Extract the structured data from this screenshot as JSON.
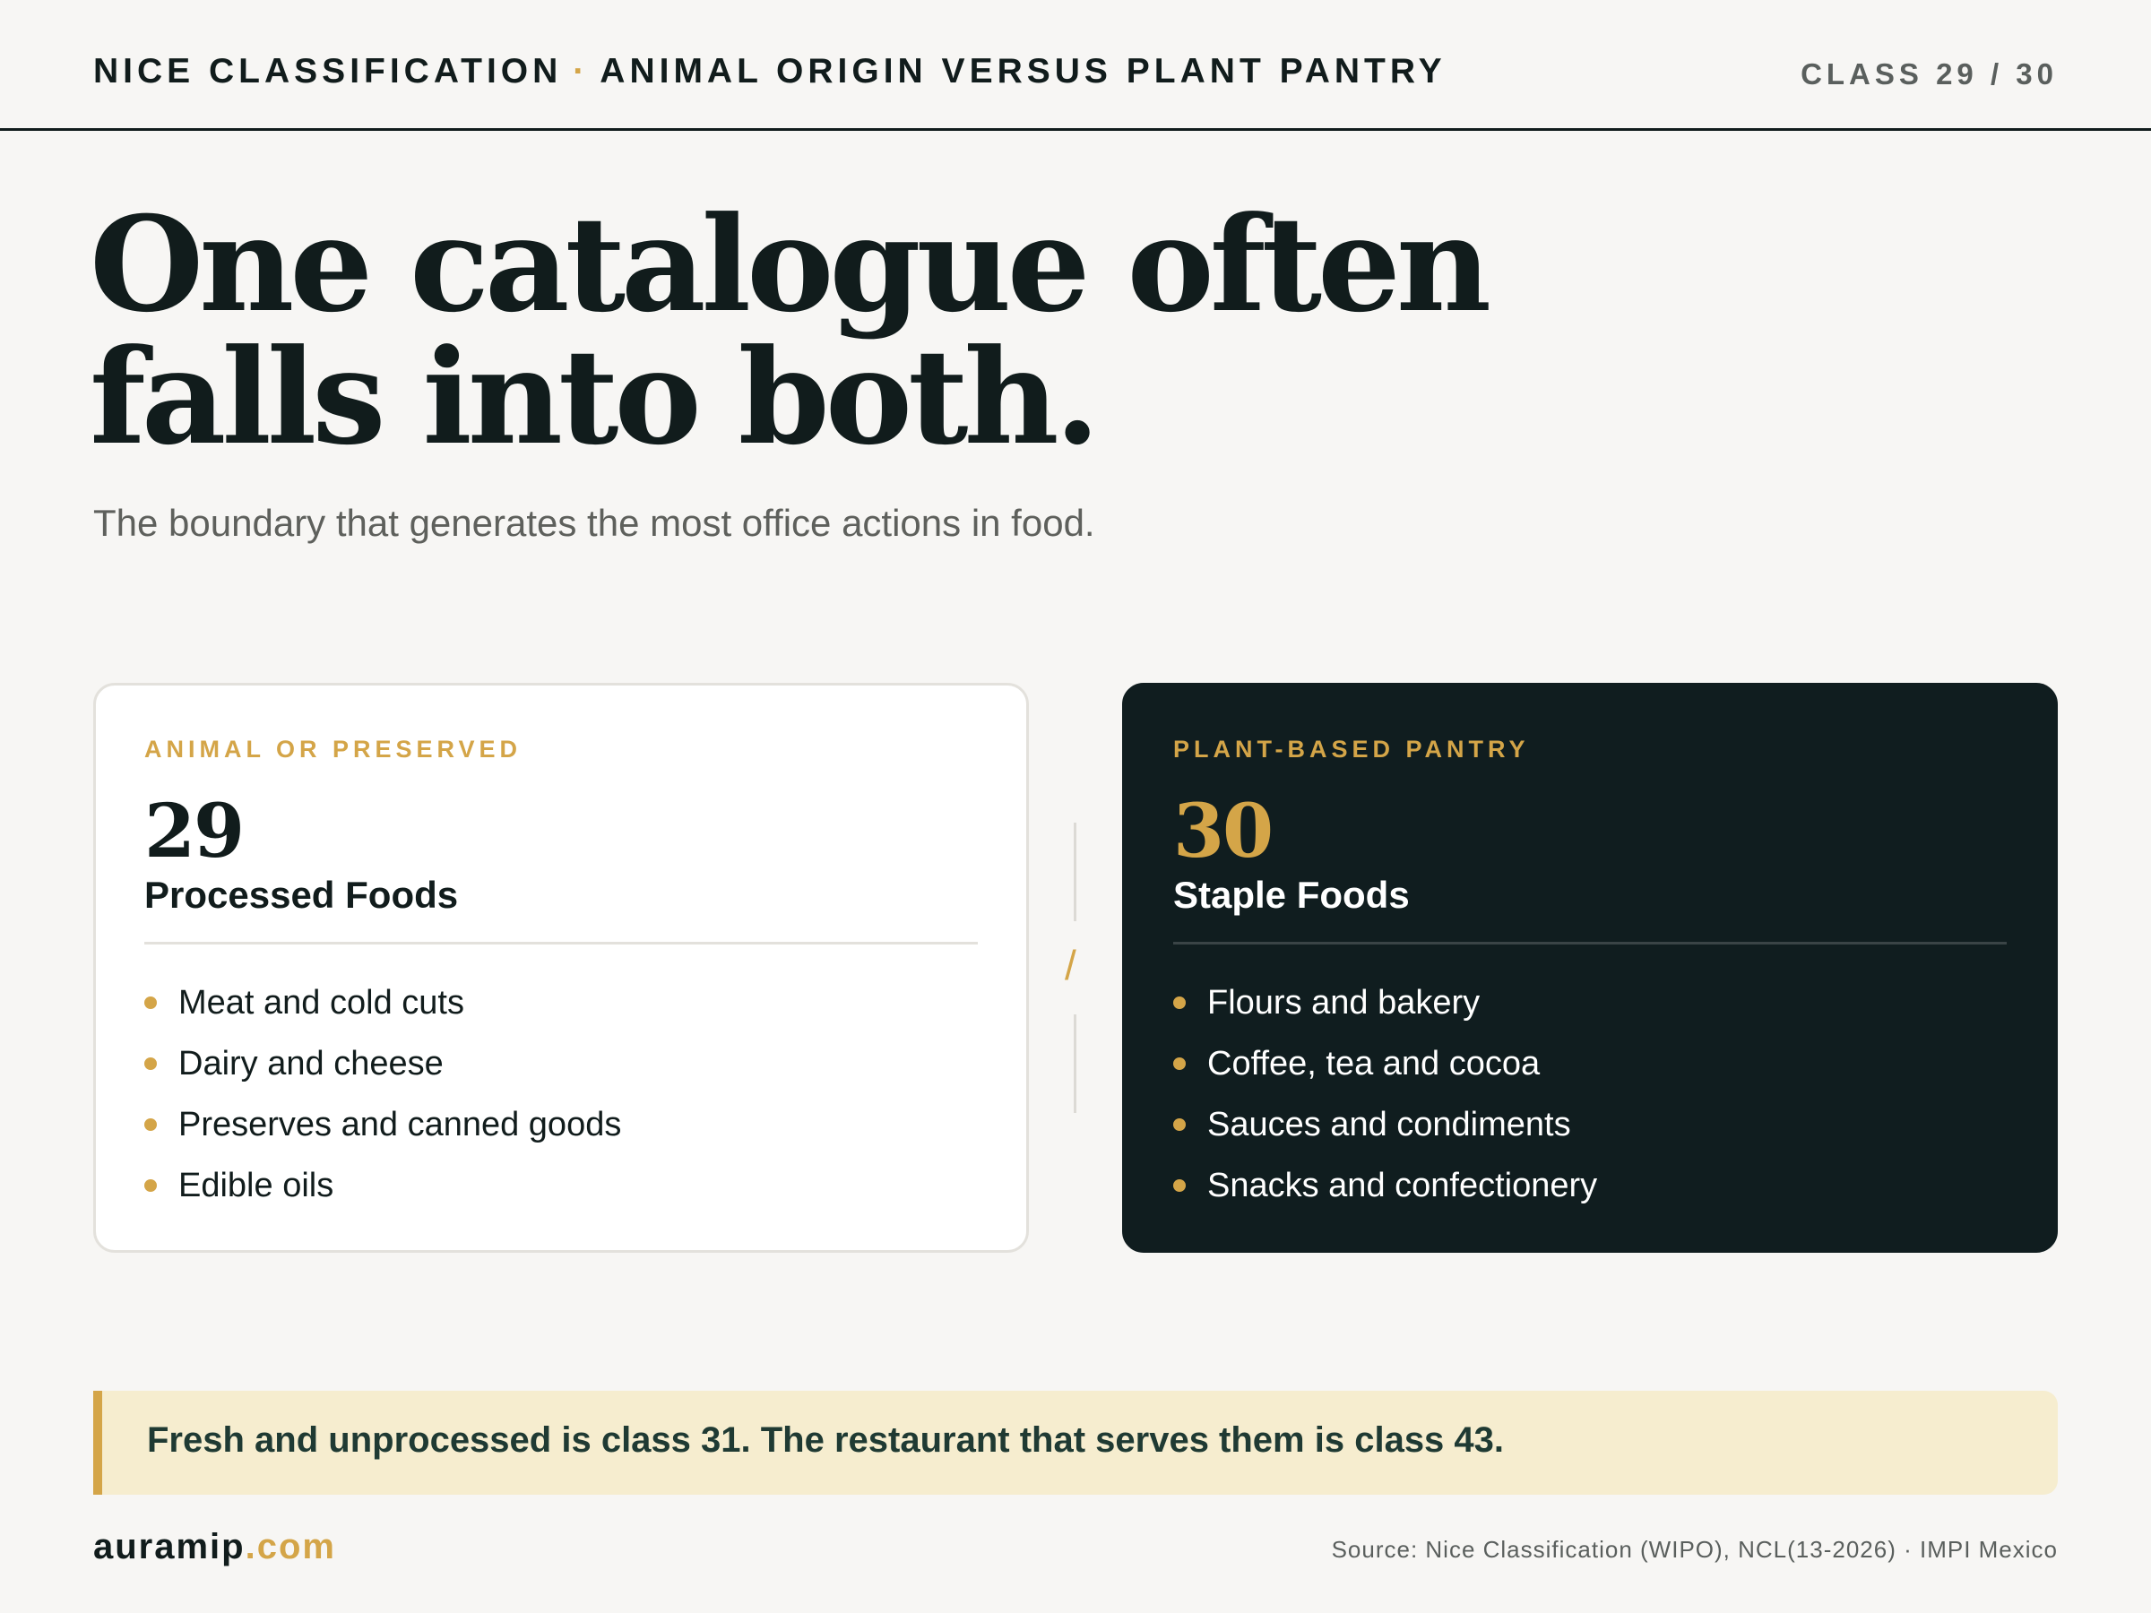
{
  "header": {
    "title_left": "NICE CLASSIFICATION",
    "separator": "·",
    "title_right": "ANIMAL ORIGIN VERSUS PLANT PANTRY",
    "page_indicator": "CLASS 29 / 30"
  },
  "headline": {
    "line1": "One catalogue often",
    "line2": "falls into both."
  },
  "subtitle": "The boundary that generates the most office actions in food.",
  "cards": [
    {
      "eyebrow": "ANIMAL OR PRESERVED",
      "class_number": "29",
      "title": "Processed Foods",
      "items": [
        "Meat and cold cuts",
        "Dairy and cheese",
        "Preserves and canned goods",
        "Edible oils"
      ]
    },
    {
      "eyebrow": "PLANT-BASED PANTRY",
      "class_number": "30",
      "title": "Staple Foods",
      "items": [
        "Flours and bakery",
        "Coffee, tea and cocoa",
        "Sauces and condiments",
        "Snacks and confectionery"
      ]
    }
  ],
  "divider_symbol": "/",
  "callout": "Fresh and unprocessed is class 31. The restaurant that serves them is class 43.",
  "footer": {
    "brand_name": "auramip",
    "brand_tld": ".com",
    "source": "Source: Nice Classification (WIPO), NCL(13-2026) · IMPI Mexico"
  },
  "colors": {
    "accent": "#d4a548",
    "ink": "#111c1c",
    "dark_card": "#101d1f",
    "callout_bg": "#f6edcf"
  }
}
